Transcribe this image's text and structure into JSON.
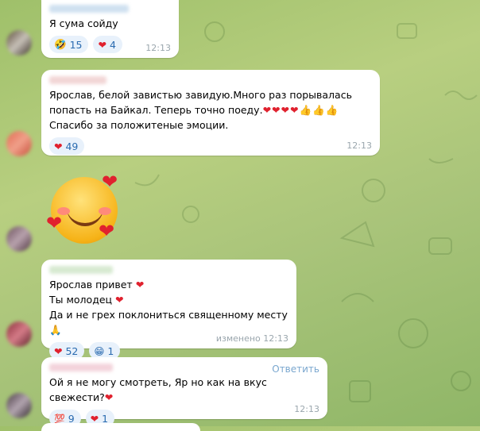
{
  "messages": [
    {
      "text": "Я сума сойду",
      "reactions": [
        {
          "emoji": "🤣",
          "count": "15"
        },
        {
          "emoji": "❤",
          "count": "4"
        }
      ],
      "time": "12:13"
    },
    {
      "text_lines": [
        "Ярослав, белой завистью завидую.Много раз порывалась",
        "попасть  на Байкал. Теперь точно поеду.",
        "Спасибо за положитеные эмоции."
      ],
      "line2_emojis": "❤❤❤❤👍👍👍",
      "reactions": [
        {
          "emoji": "❤",
          "count": "49"
        }
      ],
      "time": "12:13"
    },
    {
      "sticker": "☺",
      "sticker_hearts": "❤"
    },
    {
      "text_lines": [
        "Ярослав привет",
        "Ты молодец",
        "Да и не грех поклониться священному месту"
      ],
      "line_emojis": [
        "❤",
        "❤",
        "🙏"
      ],
      "reactions": [
        {
          "emoji": "❤",
          "count": "52"
        },
        {
          "emoji": "😁",
          "count": "1"
        }
      ],
      "time": "изменено 12:13"
    },
    {
      "reply_label": "Ответить",
      "text": "Ой я не могу смотреть, Яр но как на вкус свежести?",
      "text_emoji": "❤",
      "reactions": [
        {
          "emoji": "💯",
          "count": "9"
        },
        {
          "emoji": "❤",
          "count": "1"
        }
      ],
      "time": "12:13"
    }
  ]
}
